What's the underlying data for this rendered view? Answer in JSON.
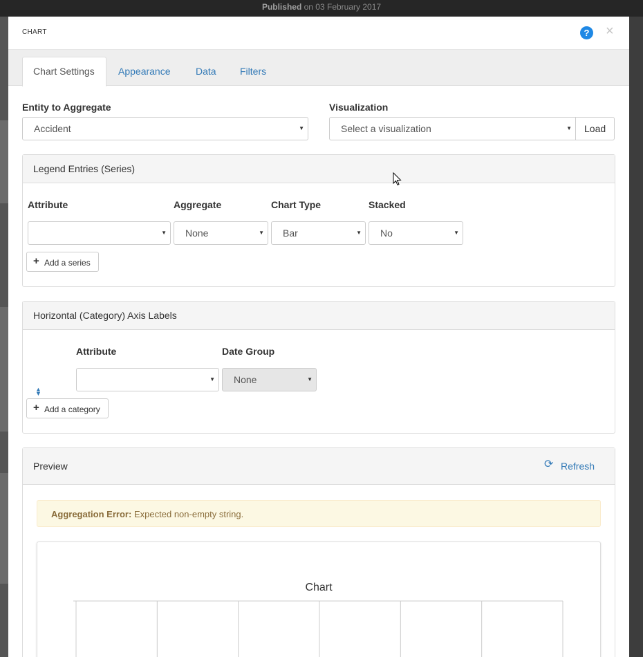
{
  "background": {
    "published_label": "Published",
    "published_date": "on 03 February 2017"
  },
  "modal": {
    "title": "CHART",
    "help_icon": "question-circle-icon",
    "close_icon": "close-icon",
    "help_glyph": "?",
    "close_glyph": "×"
  },
  "tabs": [
    {
      "label": "Chart Settings",
      "active": true
    },
    {
      "label": "Appearance",
      "active": false
    },
    {
      "label": "Data",
      "active": false
    },
    {
      "label": "Filters",
      "active": false
    }
  ],
  "entity": {
    "label": "Entity to Aggregate",
    "value": "Accident"
  },
  "visualization": {
    "label": "Visualization",
    "placeholder": "Select a visualization",
    "load_label": "Load"
  },
  "series_panel": {
    "title": "Legend Entries (Series)",
    "columns": {
      "attribute": "Attribute",
      "aggregate": "Aggregate",
      "chart_type": "Chart Type",
      "stacked": "Stacked"
    },
    "row": {
      "attribute": "",
      "aggregate": "None",
      "chart_type": "Bar",
      "stacked": "No"
    },
    "add_label": "Add a series"
  },
  "category_panel": {
    "title": "Horizontal (Category) Axis Labels",
    "columns": {
      "attribute": "Attribute",
      "date_group": "Date Group"
    },
    "row": {
      "attribute": "",
      "date_group": "None"
    },
    "add_label": "Add a category"
  },
  "preview_panel": {
    "title": "Preview",
    "refresh_label": "Refresh",
    "alert_strong": "Aggregation Error:",
    "alert_message": "Expected non-empty string."
  },
  "colors": {
    "link": "#337ab7",
    "alert_bg": "#fcf8e3",
    "alert_text": "#8a6d3b",
    "help_icon": "#1e88e5"
  },
  "chart_data": {
    "type": "bar",
    "title": "Chart",
    "categories": [],
    "series": [],
    "grid": true,
    "column_count": 6
  }
}
